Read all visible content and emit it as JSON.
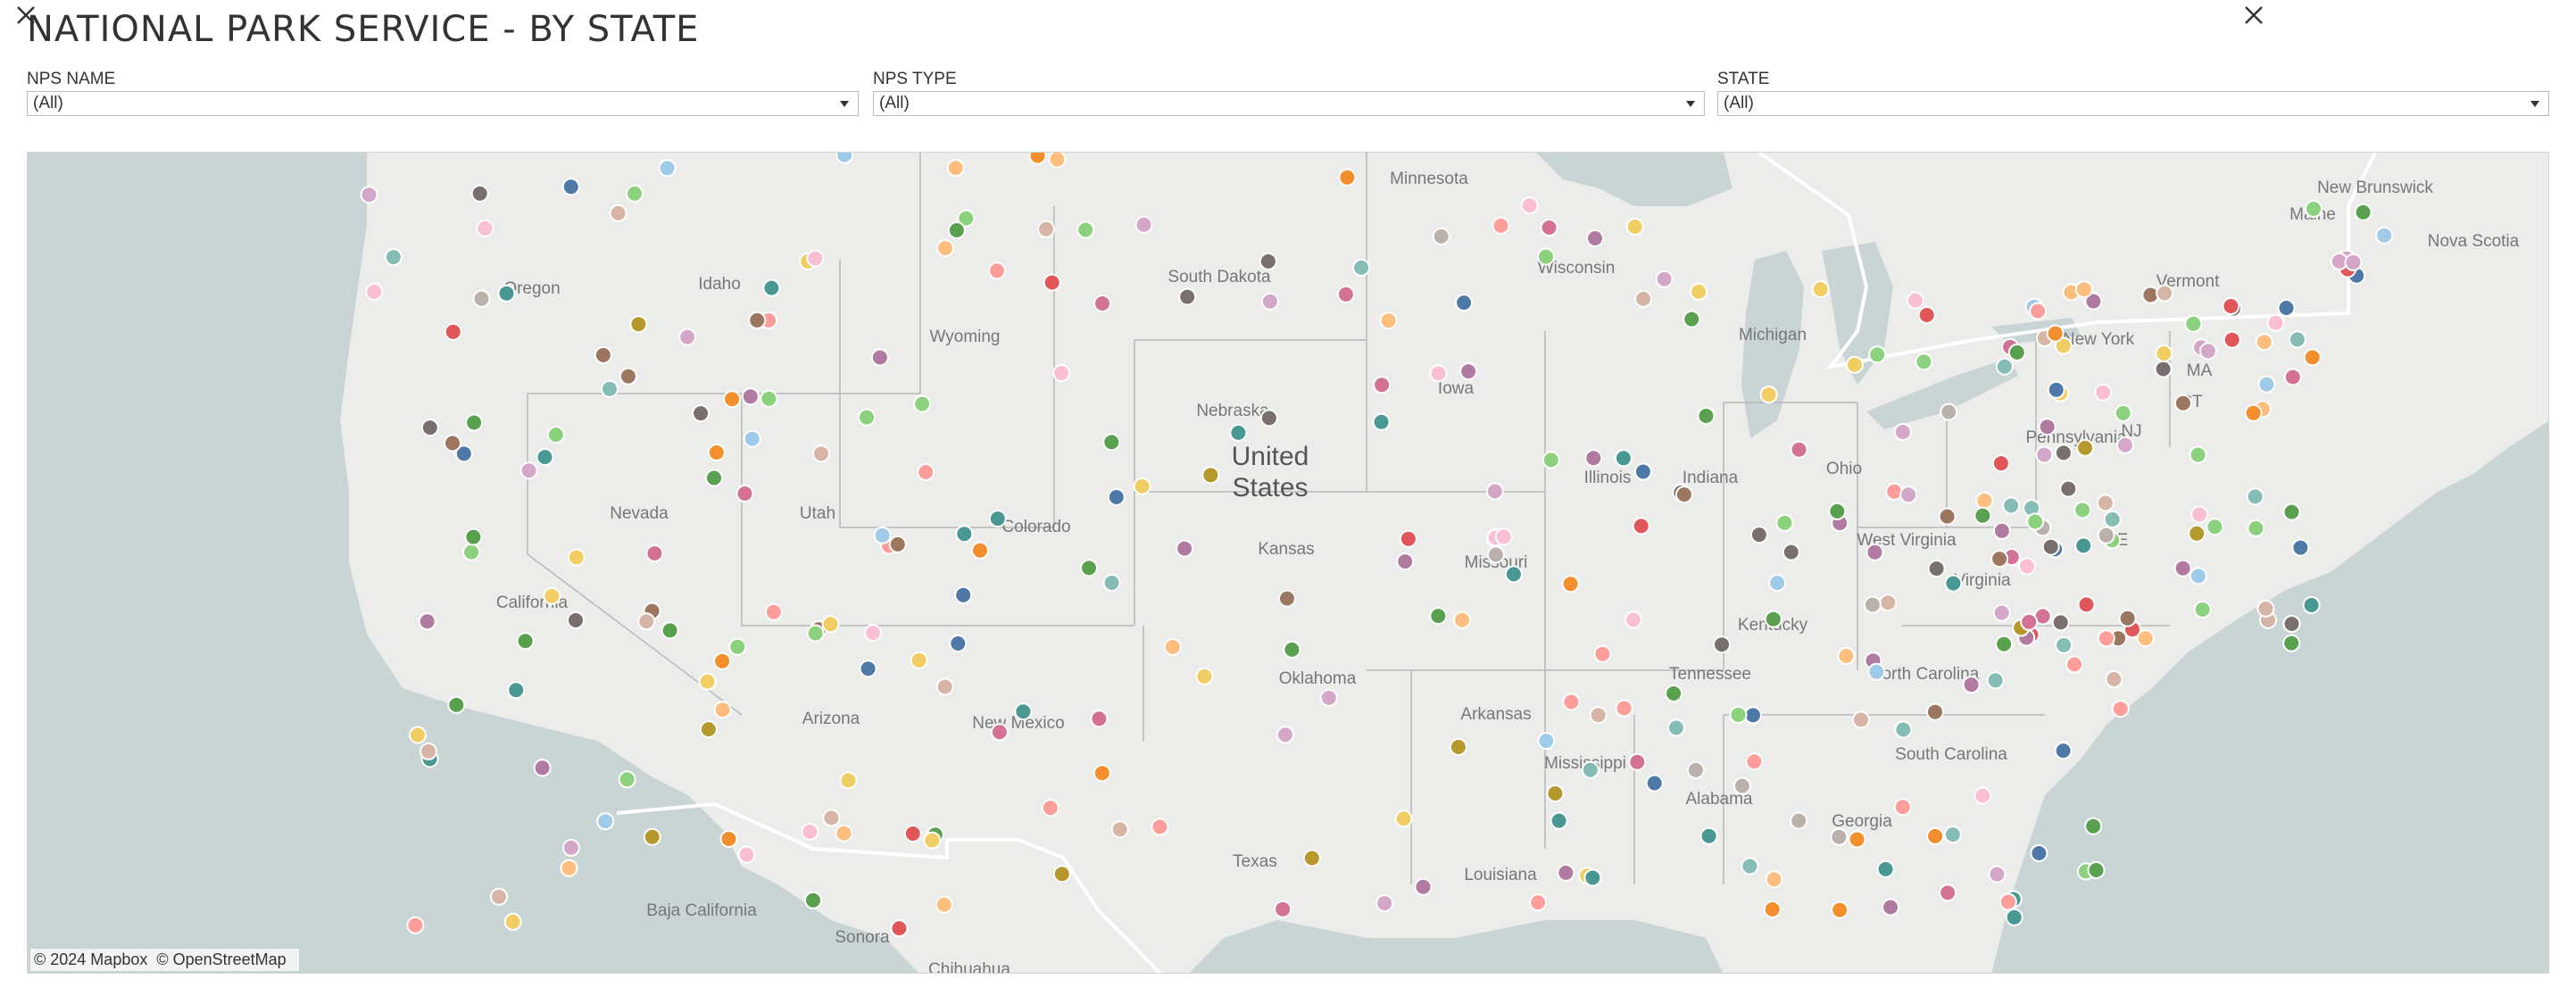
{
  "title": "NATIONAL PARK SERVICE - BY STATE",
  "filters": [
    {
      "label": "NPS NAME",
      "value": "(All)"
    },
    {
      "label": "NPS TYPE",
      "value": "(All)"
    },
    {
      "label": "STATE",
      "value": "(All)"
    }
  ],
  "map": {
    "attribution": [
      "© 2024 Mapbox",
      "© OpenStreetMap"
    ],
    "labels": {
      "country": [
        "United",
        "States"
      ],
      "states": [
        "Oregon",
        "Idaho",
        "Wyoming",
        "South Dakota",
        "Minnesota",
        "Wisconsin",
        "Michigan",
        "Nebraska",
        "Iowa",
        "Nevada",
        "Utah",
        "Colorado",
        "Kansas",
        "Missouri",
        "Illinois",
        "Indiana",
        "Ohio",
        "Pennsylvania",
        "New York",
        "Vermont",
        "Maine",
        "California",
        "Arizona",
        "New Mexico",
        "Oklahoma",
        "Texas",
        "Arkansas",
        "Louisiana",
        "Mississippi",
        "Alabama",
        "Georgia",
        "Tennessee",
        "Kentucky",
        "West Virginia",
        "Virginia",
        "North Carolina",
        "South Carolina",
        "MA",
        "CT",
        "NJ",
        "DE",
        "New Brunswick",
        "Nova Scotia",
        "Baja California",
        "Sonora",
        "Chihuahua"
      ]
    }
  },
  "colors": {
    "land": "#ececea",
    "water": "#c9d4d4",
    "state_border": "#b8b8b8",
    "country_border": "#ffffff",
    "dot_palette": [
      "#4e79a7",
      "#a0cbe8",
      "#f28e2b",
      "#ffbe7d",
      "#59a14f",
      "#8cd17d",
      "#b6992d",
      "#f1ce63",
      "#499894",
      "#86bcb6",
      "#e15759",
      "#ff9d9a",
      "#79706e",
      "#bab0ac",
      "#d37295",
      "#fabfd2",
      "#b07aa1",
      "#d4a6c8",
      "#9d7660",
      "#d7b5a6"
    ]
  }
}
